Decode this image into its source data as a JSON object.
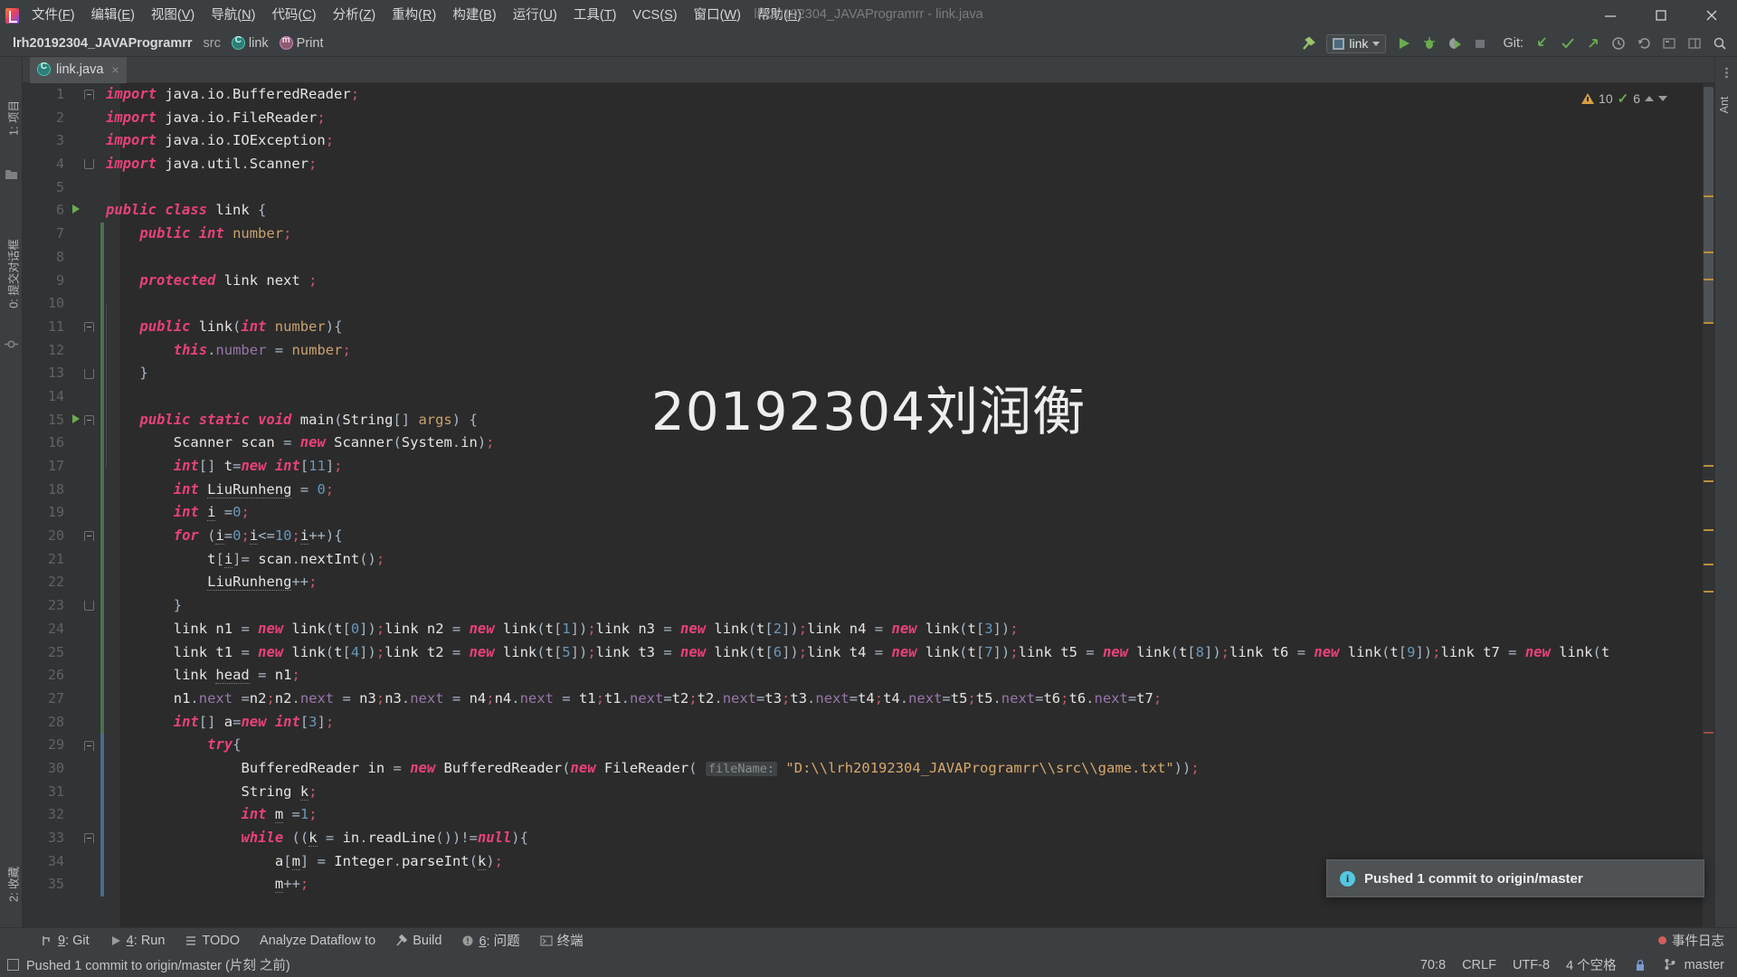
{
  "window": {
    "title": "lrh20192304_JAVAProgramrr - link.java",
    "menu": [
      {
        "label": "文件",
        "mnemonic": "F"
      },
      {
        "label": "编辑",
        "mnemonic": "E"
      },
      {
        "label": "视图",
        "mnemonic": "V"
      },
      {
        "label": "导航",
        "mnemonic": "N"
      },
      {
        "label": "代码",
        "mnemonic": "C"
      },
      {
        "label": "分析",
        "mnemonic": "Z"
      },
      {
        "label": "重构",
        "mnemonic": "R"
      },
      {
        "label": "构建",
        "mnemonic": "B"
      },
      {
        "label": "运行",
        "mnemonic": "U"
      },
      {
        "label": "工具",
        "mnemonic": "T"
      },
      {
        "label": "VCS",
        "mnemonic": "S"
      },
      {
        "label": "窗口",
        "mnemonic": "W"
      },
      {
        "label": "帮助",
        "mnemonic": "H"
      }
    ],
    "controls": {
      "minimize": "minimize-icon",
      "maximize": "maximize-icon",
      "close": "close-icon"
    }
  },
  "navbar": {
    "breadcrumbs": [
      "lrh20192304_JAVAProgramrr",
      "src",
      "link",
      "Print"
    ],
    "run_config": "link",
    "git_label": "Git:",
    "icons": [
      "build-hammer-icon",
      "run-icon",
      "debug-icon",
      "run-coverage-icon",
      "stop-icon",
      "git-update-icon",
      "git-commit-icon",
      "git-push-icon",
      "git-history-icon",
      "undo-icon",
      "search-everywhere-icon",
      "settings-icon",
      "magnifier-icon"
    ]
  },
  "left_tool_strip": [
    {
      "label": "1: 项目",
      "name": "project"
    },
    {
      "label": "0: 提交对话框",
      "name": "commit"
    },
    {
      "label": "2: 收藏",
      "name": "favorites"
    }
  ],
  "right_tool_strip": [
    {
      "label": "Ant",
      "name": "ant"
    }
  ],
  "editor": {
    "tab": {
      "label": "link.java",
      "close": "×"
    },
    "watermark": "20192304刘润衡",
    "inspection": {
      "warnings": "10",
      "checks": "6"
    },
    "lines": [
      {
        "n": 1,
        "fold": "top",
        "text": "import java.io.BufferedReader;"
      },
      {
        "n": 2,
        "fold": "",
        "text": "import java.io.FileReader;"
      },
      {
        "n": 3,
        "fold": "",
        "text": "import java.io.IOException;"
      },
      {
        "n": 4,
        "fold": "bot",
        "text": "import java.util.Scanner;"
      },
      {
        "n": 5,
        "fold": "",
        "text": ""
      },
      {
        "n": 6,
        "fold": "",
        "run": true,
        "text": "public class link {"
      },
      {
        "n": 7,
        "fold": "",
        "text": "    public int number;"
      },
      {
        "n": 8,
        "fold": "",
        "text": ""
      },
      {
        "n": 9,
        "fold": "",
        "text": "    protected link next ;"
      },
      {
        "n": 10,
        "fold": "",
        "text": ""
      },
      {
        "n": 11,
        "fold": "top",
        "text": "    public link(int number){"
      },
      {
        "n": 12,
        "fold": "",
        "text": "        this.number = number;"
      },
      {
        "n": 13,
        "fold": "bot",
        "text": "    }"
      },
      {
        "n": 14,
        "fold": "",
        "text": ""
      },
      {
        "n": 15,
        "fold": "top",
        "run": true,
        "text": "    public static void main(String[] args) {"
      },
      {
        "n": 16,
        "fold": "",
        "text": "        Scanner scan = new Scanner(System.in);"
      },
      {
        "n": 17,
        "fold": "",
        "text": "        int[] t=new int[11];"
      },
      {
        "n": 18,
        "fold": "",
        "text": "        int LiuRunheng = 0;"
      },
      {
        "n": 19,
        "fold": "",
        "text": "        int i =0;"
      },
      {
        "n": 20,
        "fold": "top",
        "text": "        for (i=0;i<=10;i++){"
      },
      {
        "n": 21,
        "fold": "",
        "text": "            t[i]= scan.nextInt();"
      },
      {
        "n": 22,
        "fold": "",
        "text": "            LiuRunheng++;"
      },
      {
        "n": 23,
        "fold": "bot",
        "text": "        }"
      },
      {
        "n": 24,
        "fold": "",
        "text": "        link n1 = new link(t[0]);link n2 = new link(t[1]);link n3 = new link(t[2]);link n4 = new link(t[3]);"
      },
      {
        "n": 25,
        "fold": "",
        "text": "        link t1 = new link(t[4]);link t2 = new link(t[5]);link t3 = new link(t[6]);link t4 = new link(t[7]);link t5 = new link(t[8]);link t6 = new link(t[9]);link t7 = new link(t"
      },
      {
        "n": 26,
        "fold": "",
        "text": "        link head = n1;"
      },
      {
        "n": 27,
        "fold": "",
        "text": "        n1.next =n2;n2.next = n3;n3.next = n4;n4.next = t1;t1.next=t2;t2.next=t3;t3.next=t4;t4.next=t5;t5.next=t6;t6.next=t7;"
      },
      {
        "n": 28,
        "fold": "",
        "text": "        int[] a=new int[3];"
      },
      {
        "n": 29,
        "fold": "top",
        "text": "            try{"
      },
      {
        "n": 30,
        "fold": "",
        "text": "                BufferedReader in = new BufferedReader(new FileReader( fileName: \"D:\\\\lrh20192304_JAVAProgramrr\\\\src\\\\game.txt\"));"
      },
      {
        "n": 31,
        "fold": "",
        "text": "                String k;"
      },
      {
        "n": 32,
        "fold": "",
        "text": "                int m =1;"
      },
      {
        "n": 33,
        "fold": "top",
        "text": "                while ((k = in.readLine())!=null){"
      },
      {
        "n": 34,
        "fold": "",
        "text": "                    a[m] = Integer.parseInt(k);"
      },
      {
        "n": 35,
        "fold": "",
        "text": "                    m++;"
      }
    ]
  },
  "notification": {
    "icon": "info-icon",
    "text": "Pushed 1 commit to origin/master"
  },
  "bottom_bar": {
    "windows": [
      {
        "num": "9",
        "label": "Git",
        "icon": "git-icon"
      },
      {
        "num": "4",
        "label": "Run",
        "icon": "run-icon"
      },
      {
        "num": "",
        "label": "TODO",
        "icon": "todo-icon"
      },
      {
        "num": "",
        "label": "Analyze Dataflow to",
        "icon": ""
      },
      {
        "num": "",
        "label": "Build",
        "icon": "build-icon"
      },
      {
        "num": "6",
        "label": "问题",
        "icon": "problems-icon"
      },
      {
        "num": "",
        "label": "终端",
        "icon": "terminal-icon"
      }
    ],
    "event_log": "事件日志"
  },
  "status_bar": {
    "message": "Pushed 1 commit to origin/master (片刻 之前)",
    "caret": "70:8",
    "line_separator": "CRLF",
    "encoding": "UTF-8",
    "indent": "4 个空格",
    "branch": "master",
    "lock_icon": "lock-icon",
    "branch_icon": "branch-icon"
  },
  "colors": {
    "accent_green": "#6aab50",
    "keyword": "#cc7832",
    "string": "#d6a86c",
    "number": "#6897bb",
    "field": "#9876aa",
    "info": "#55c8e0",
    "warning": "#d6a042"
  }
}
